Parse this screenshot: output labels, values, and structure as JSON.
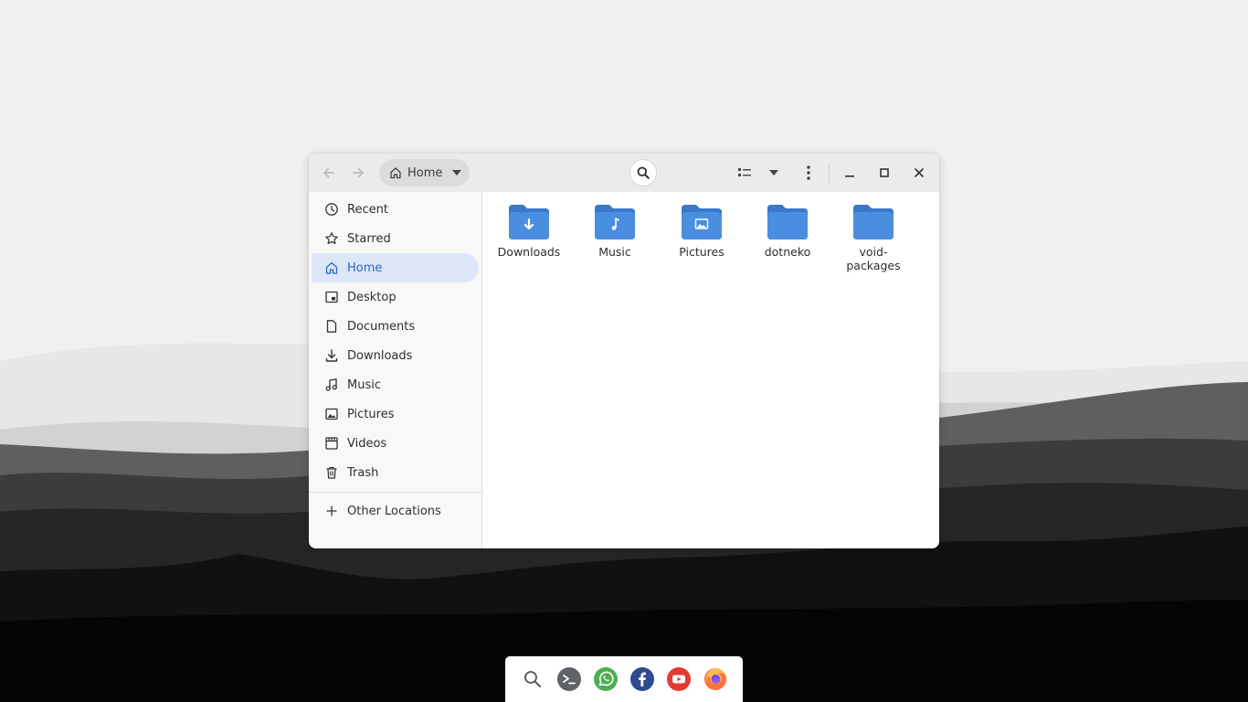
{
  "colors": {
    "accent": "#2a66c8",
    "folder_blue": "#4a8ee0",
    "sidebar_active_bg": "#dde6f6",
    "whatsapp": "#4caf50",
    "facebook": "#2d4b8e",
    "youtube": "#e53935",
    "terminal": "#5f6368"
  },
  "headerbar": {
    "back_icon": "arrow-left-icon",
    "forward_icon": "arrow-right-icon",
    "location": "Home",
    "search_icon": "search-icon",
    "view_icon": "list-view-icon",
    "sort_icon": "chevron-down-icon",
    "menu_icon": "kebab-menu-icon",
    "window_controls": [
      "minimize-icon",
      "maximize-icon",
      "close-icon"
    ]
  },
  "sidebar": {
    "items": [
      {
        "label": "Recent",
        "icon": "clock-icon",
        "active": false
      },
      {
        "label": "Starred",
        "icon": "star-icon",
        "active": false
      },
      {
        "label": "Home",
        "icon": "home-icon",
        "active": true
      },
      {
        "label": "Desktop",
        "icon": "desktop-icon",
        "active": false
      },
      {
        "label": "Documents",
        "icon": "document-icon",
        "active": false
      },
      {
        "label": "Downloads",
        "icon": "download-icon",
        "active": false
      },
      {
        "label": "Music",
        "icon": "music-icon",
        "active": false
      },
      {
        "label": "Pictures",
        "icon": "picture-icon",
        "active": false
      },
      {
        "label": "Videos",
        "icon": "film-icon",
        "active": false
      },
      {
        "label": "Trash",
        "icon": "trash-icon",
        "active": false
      }
    ],
    "other_locations": {
      "label": "Other Locations",
      "icon": "plus-icon"
    }
  },
  "files": [
    {
      "name": "Downloads",
      "emblem": "download-icon"
    },
    {
      "name": "Music",
      "emblem": "music-icon"
    },
    {
      "name": "Pictures",
      "emblem": "picture-icon"
    },
    {
      "name": "dotneko",
      "emblem": "none"
    },
    {
      "name": "void-\npackages",
      "emblem": "none"
    }
  ],
  "dock": {
    "items": [
      {
        "name": "search",
        "icon": "search-icon"
      },
      {
        "name": "terminal",
        "icon": "terminal-icon"
      },
      {
        "name": "whatsapp",
        "icon": "whatsapp-icon"
      },
      {
        "name": "facebook",
        "icon": "facebook-icon"
      },
      {
        "name": "youtube",
        "icon": "youtube-icon"
      },
      {
        "name": "firefox",
        "icon": "firefox-icon"
      }
    ]
  }
}
